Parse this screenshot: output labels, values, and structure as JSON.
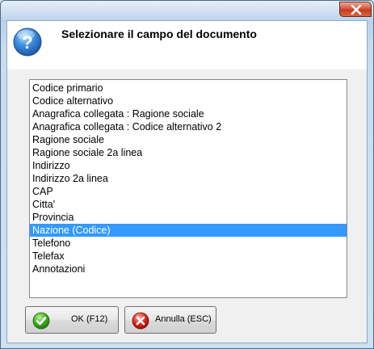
{
  "window": {
    "close_icon": "close-icon"
  },
  "dialog": {
    "icon": "question-icon",
    "title": "Selezionare il campo del documento"
  },
  "list": {
    "items": [
      "Codice primario",
      "Codice alternativo",
      "Anagrafica collegata : Ragione sociale",
      "Anagrafica collegata : Codice alternativo 2",
      "Ragione sociale",
      "Ragione sociale 2a linea",
      "Indirizzo",
      "Indirizzo 2a linea",
      "CAP",
      "Citta'",
      "Provincia",
      "Nazione (Codice)",
      "Telefono",
      "Telefax",
      "Annotazioni"
    ],
    "selected_item": "Nazione (Codice)"
  },
  "buttons": {
    "ok_label": "OK (F12)",
    "ok_icon": "check-icon",
    "cancel_label": "Annulla (ESC)",
    "cancel_icon": "cancel-icon"
  },
  "colors": {
    "selection": "#3399ff",
    "close_button": "#c43c1f",
    "ok_icon": "#3cae1e",
    "cancel_icon": "#d8281c"
  }
}
